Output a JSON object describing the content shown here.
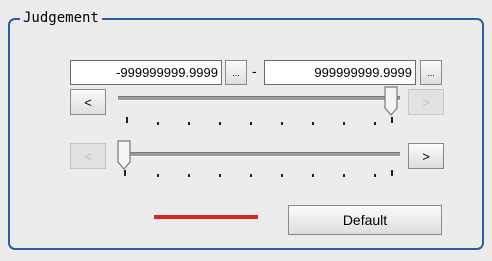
{
  "group": {
    "title": "Judgement"
  },
  "range": {
    "lower_value": "-999999999.9999",
    "upper_value": "999999999.9999",
    "separator": "-",
    "browse_label": "..."
  },
  "slider_upper": {
    "left_label": "<",
    "right_label": ">",
    "left_enabled": true,
    "right_enabled": false,
    "position": 1.0
  },
  "slider_lower": {
    "left_label": "<",
    "right_label": ">",
    "left_enabled": false,
    "right_enabled": true,
    "position": 0.0
  },
  "indicator": {
    "color": "#e02424"
  },
  "buttons": {
    "default_label": "Default"
  }
}
